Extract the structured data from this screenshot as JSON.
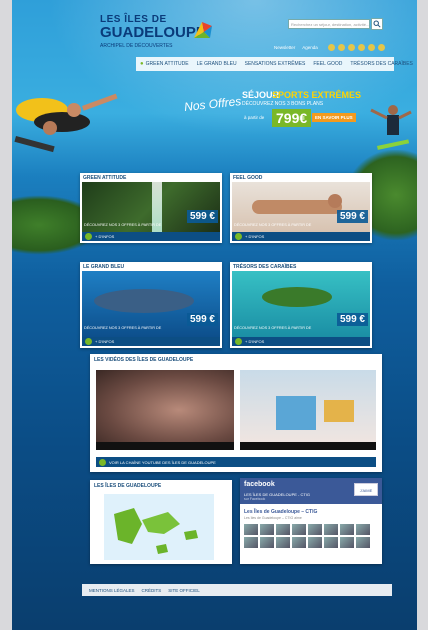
{
  "brand": {
    "line1": "LES ÎLES DE",
    "line2": "GUADELOUPE",
    "line3": "ARCHIPEL DE DÉCOUVERTES"
  },
  "search": {
    "placeholder": "Recherchez un séjour, destination, activité..."
  },
  "utility": {
    "links": [
      "Newsletter",
      "Agenda"
    ]
  },
  "social_icons": [
    "facebook-icon",
    "twitter-icon",
    "youtube-icon",
    "flickr-icon",
    "rss-icon",
    "share-icon"
  ],
  "nav": {
    "items": [
      "GREEN ATTITUDE",
      "LE GRAND BLEU",
      "SENSATIONS EXTRÊMES",
      "FEEL GOOD",
      "TRÉSORS DES CARAÏBES"
    ]
  },
  "hero": {
    "offers_label": "Nos Offres",
    "promo_word1": "SÉJOUR",
    "promo_word2": "SPORTS EXTRÊMES",
    "promo_sub": "DÉCOUVREZ NOS 3 BONS PLANS",
    "promo_from": "à partir de",
    "promo_price": "799€",
    "promo_cta": "EN SAVOIR PLUS"
  },
  "cards": [
    {
      "title": "GREEN ATTITUDE",
      "desc": "DÉCOUVREZ NOS 3 OFFRES À PARTIR DE",
      "price": "599 €",
      "cta": "+ D'INFOS"
    },
    {
      "title": "FEEL GOOD",
      "desc": "DÉCOUVREZ NOS 3 OFFRES À PARTIR DE",
      "price": "599 €",
      "cta": "+ D'INFOS"
    },
    {
      "title": "LE GRAND BLEU",
      "desc": "DÉCOUVREZ NOS 3 OFFRES À PARTIR DE",
      "price": "599 €",
      "cta": "+ D'INFOS"
    },
    {
      "title": "TRÉSORS DES CARAÏBES",
      "desc": "DÉCOUVREZ NOS 3 OFFRES À PARTIR DE",
      "price": "599 €",
      "cta": "+ D'INFOS"
    }
  ],
  "videos": {
    "title": "LES VIDÉOS DES ÎLES DE GUADELOUPE",
    "channel_link": "VOIR LA CHAÎNE YOUTUBE DES ÎLES DE GUADELOUPE"
  },
  "map": {
    "title": "LES ÎLES DE GUADELOUPE"
  },
  "facebook": {
    "brand": "facebook",
    "page_title": "LES ÎLES DE GUADELOUPE - CTIG",
    "page_sub": "sur Facebook",
    "like_label": "J'AIME",
    "page_name": "Les Îles de Guadeloupe – CTIG",
    "likes_line": "Les îles de Guadeloupe – CTIG aime"
  },
  "footer": {
    "links": [
      "MENTIONS LÉGALES",
      "CRÉDITS",
      "SITE OFFICIEL"
    ]
  },
  "colors": {
    "accent_green": "#7ab827",
    "accent_orange": "#f39a1e",
    "navy": "#0c4e84",
    "facebook_blue": "#3b5998"
  }
}
